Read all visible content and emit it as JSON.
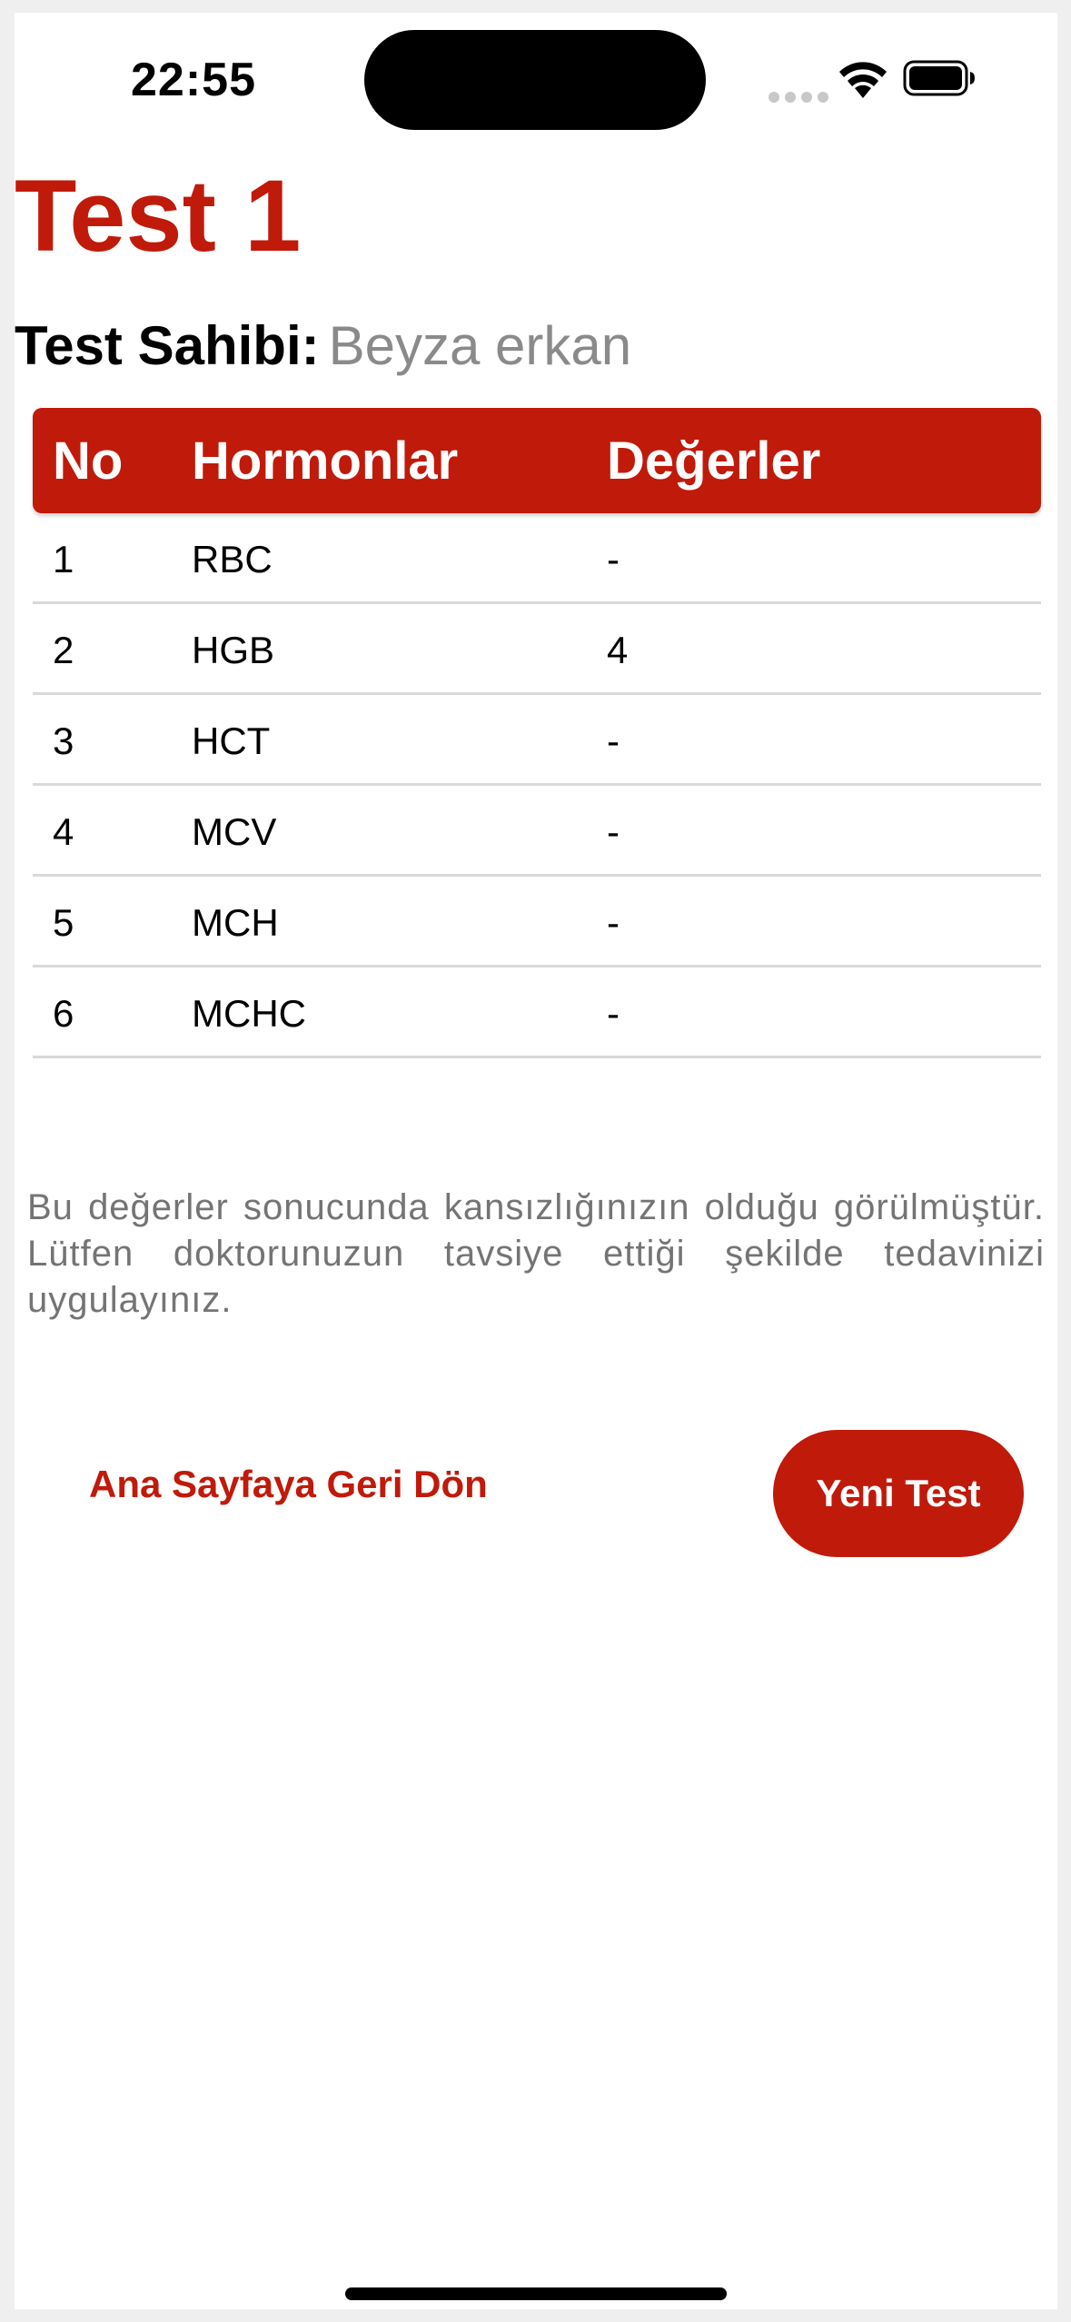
{
  "status_bar": {
    "time": "22:55",
    "icons": [
      "cellular-signal-icon",
      "wifi-icon",
      "battery-icon"
    ]
  },
  "page": {
    "title": "Test 1",
    "owner_label": "Test Sahibi:",
    "owner_name": "Beyza erkan"
  },
  "table": {
    "headers": [
      "No",
      "Hormonlar",
      "Değerler"
    ],
    "rows": [
      {
        "no": "1",
        "hormone": "RBC",
        "value": "-"
      },
      {
        "no": "2",
        "hormone": "HGB",
        "value": "4"
      },
      {
        "no": "3",
        "hormone": "HCT",
        "value": "-"
      },
      {
        "no": "4",
        "hormone": "MCV",
        "value": "-"
      },
      {
        "no": "5",
        "hormone": "MCH",
        "value": "-"
      },
      {
        "no": "6",
        "hormone": "MCHC",
        "value": "-"
      }
    ]
  },
  "result_note": "Bu değerler sonucunda kansızlığınızın olduğu görülmüştür. Lütfen doktorunuzun tavsiye ettiği şekilde tedavinizi uygulayınız.",
  "actions": {
    "home_link_label": "Ana Sayfaya Geri Dön",
    "new_test_label": "Yeni Test"
  },
  "colors": {
    "accent": "#c01a0a",
    "muted_text": "#8a8a8a",
    "divider": "#d9d9d9"
  }
}
